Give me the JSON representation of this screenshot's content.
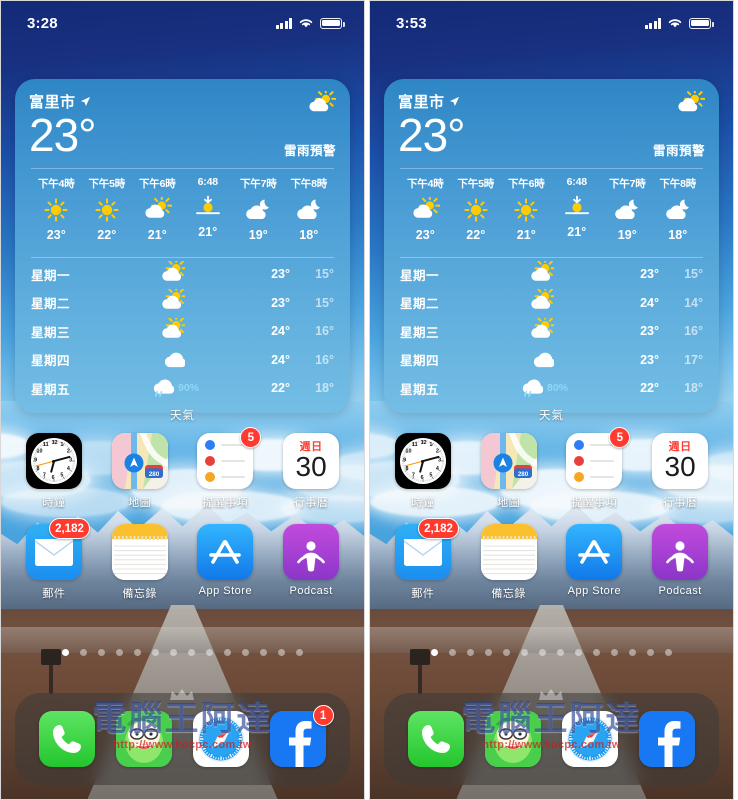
{
  "panels": [
    {
      "id": "left",
      "status": {
        "time": "3:28",
        "signal_icon": "signal-bars-icon",
        "wifi_icon": "wifi-icon",
        "battery_icon": "battery-icon"
      },
      "widget": {
        "city": "富里市",
        "location_icon": "location-arrow-icon",
        "temperature": "23°",
        "condition_icon": "partly-cloudy-icon",
        "alert": "雷雨預警",
        "label": "天氣",
        "hours": [
          {
            "label": "下午4時",
            "icon": "sunny",
            "temp": "23°"
          },
          {
            "label": "下午5時",
            "icon": "sunny",
            "temp": "22°"
          },
          {
            "label": "下午6時",
            "icon": "partly-cloudy",
            "temp": "21°"
          },
          {
            "label": "6:48",
            "icon": "sunset",
            "temp": "21°"
          },
          {
            "label": "下午7時",
            "icon": "cloudy-night",
            "temp": "19°"
          },
          {
            "label": "下午8時",
            "icon": "cloudy-night",
            "temp": "18°"
          }
        ],
        "days": [
          {
            "name": "星期一",
            "icon": "partly-cloudy",
            "pop": "",
            "high": "23°",
            "low": "15°"
          },
          {
            "name": "星期二",
            "icon": "partly-cloudy",
            "pop": "",
            "high": "23°",
            "low": "15°"
          },
          {
            "name": "星期三",
            "icon": "partly-cloudy",
            "pop": "",
            "high": "24°",
            "low": "16°"
          },
          {
            "name": "星期四",
            "icon": "cloudy",
            "pop": "",
            "high": "24°",
            "low": "16°"
          },
          {
            "name": "星期五",
            "icon": "rain",
            "pop": "90%",
            "high": "22°",
            "low": "18°"
          }
        ]
      },
      "apps_row1": [
        {
          "label": "時鐘",
          "icon": "clock-app-icon",
          "badge": ""
        },
        {
          "label": "地圖",
          "icon": "maps-app-icon",
          "badge": ""
        },
        {
          "label": "提醒事項",
          "icon": "reminders-app-icon",
          "badge": "5"
        },
        {
          "label": "行事曆",
          "icon": "calendar-app-icon",
          "badge": "",
          "cal_dow": "週日",
          "cal_day": "30"
        }
      ],
      "apps_row2": [
        {
          "label": "郵件",
          "icon": "mail-app-icon",
          "badge": "2,182"
        },
        {
          "label": "備忘錄",
          "icon": "notes-app-icon",
          "badge": ""
        },
        {
          "label": "App Store",
          "icon": "appstore-app-icon",
          "badge": ""
        },
        {
          "label": "Podcast",
          "icon": "podcasts-app-icon",
          "badge": ""
        }
      ],
      "dock": [
        {
          "label": "phone",
          "icon": "phone-app-icon",
          "badge": ""
        },
        {
          "label": "line",
          "icon": "line-app-icon",
          "badge": ""
        },
        {
          "label": "safari",
          "icon": "safari-app-icon",
          "badge": ""
        },
        {
          "label": "facebook",
          "icon": "facebook-app-icon",
          "badge": "1"
        }
      ],
      "page_dots": {
        "count": 14,
        "active_index": 0
      }
    },
    {
      "id": "right",
      "status": {
        "time": "3:53",
        "signal_icon": "signal-bars-icon",
        "wifi_icon": "wifi-icon",
        "battery_icon": "battery-icon"
      },
      "widget": {
        "city": "富里市",
        "location_icon": "location-arrow-icon",
        "temperature": "23°",
        "condition_icon": "partly-cloudy-icon",
        "alert": "雷雨預警",
        "label": "天氣",
        "hours": [
          {
            "label": "下午4時",
            "icon": "partly-cloudy",
            "temp": "23°"
          },
          {
            "label": "下午5時",
            "icon": "sunny",
            "temp": "22°"
          },
          {
            "label": "下午6時",
            "icon": "sunny",
            "temp": "21°"
          },
          {
            "label": "6:48",
            "icon": "sunset",
            "temp": "21°"
          },
          {
            "label": "下午7時",
            "icon": "cloudy-night",
            "temp": "19°"
          },
          {
            "label": "下午8時",
            "icon": "cloudy-night",
            "temp": "18°"
          }
        ],
        "days": [
          {
            "name": "星期一",
            "icon": "partly-cloudy",
            "pop": "",
            "high": "23°",
            "low": "15°"
          },
          {
            "name": "星期二",
            "icon": "partly-cloudy",
            "pop": "",
            "high": "24°",
            "low": "14°"
          },
          {
            "name": "星期三",
            "icon": "partly-cloudy",
            "pop": "",
            "high": "23°",
            "low": "16°"
          },
          {
            "name": "星期四",
            "icon": "cloudy",
            "pop": "",
            "high": "23°",
            "low": "17°"
          },
          {
            "name": "星期五",
            "icon": "rain",
            "pop": "80%",
            "high": "22°",
            "low": "18°"
          }
        ]
      },
      "apps_row1": [
        {
          "label": "時鐘",
          "icon": "clock-app-icon",
          "badge": ""
        },
        {
          "label": "地圖",
          "icon": "maps-app-icon",
          "badge": ""
        },
        {
          "label": "提醒事項",
          "icon": "reminders-app-icon",
          "badge": "5"
        },
        {
          "label": "行事曆",
          "icon": "calendar-app-icon",
          "badge": "",
          "cal_dow": "週日",
          "cal_day": "30"
        }
      ],
      "apps_row2": [
        {
          "label": "郵件",
          "icon": "mail-app-icon",
          "badge": "2,182"
        },
        {
          "label": "備忘錄",
          "icon": "notes-app-icon",
          "badge": ""
        },
        {
          "label": "App Store",
          "icon": "appstore-app-icon",
          "badge": ""
        },
        {
          "label": "Podcast",
          "icon": "podcasts-app-icon",
          "badge": ""
        }
      ],
      "dock": [
        {
          "label": "phone",
          "icon": "phone-app-icon",
          "badge": ""
        },
        {
          "label": "line",
          "icon": "line-app-icon",
          "badge": ""
        },
        {
          "label": "safari",
          "icon": "safari-app-icon",
          "badge": ""
        },
        {
          "label": "facebook",
          "icon": "facebook-app-icon",
          "badge": ""
        }
      ],
      "page_dots": {
        "count": 14,
        "active_index": 0
      }
    }
  ],
  "watermark": {
    "text": "電腦王阿達",
    "url": "http://www.kocpc.com.tw"
  },
  "colors": {
    "badge_red": "#ff3b30",
    "widget_top": "#2f86c5",
    "widget_bottom": "#74bee5",
    "sky_dark": "#132a78",
    "sun_yellow": "#ffcc00",
    "accent_orange": "#ff9500"
  }
}
